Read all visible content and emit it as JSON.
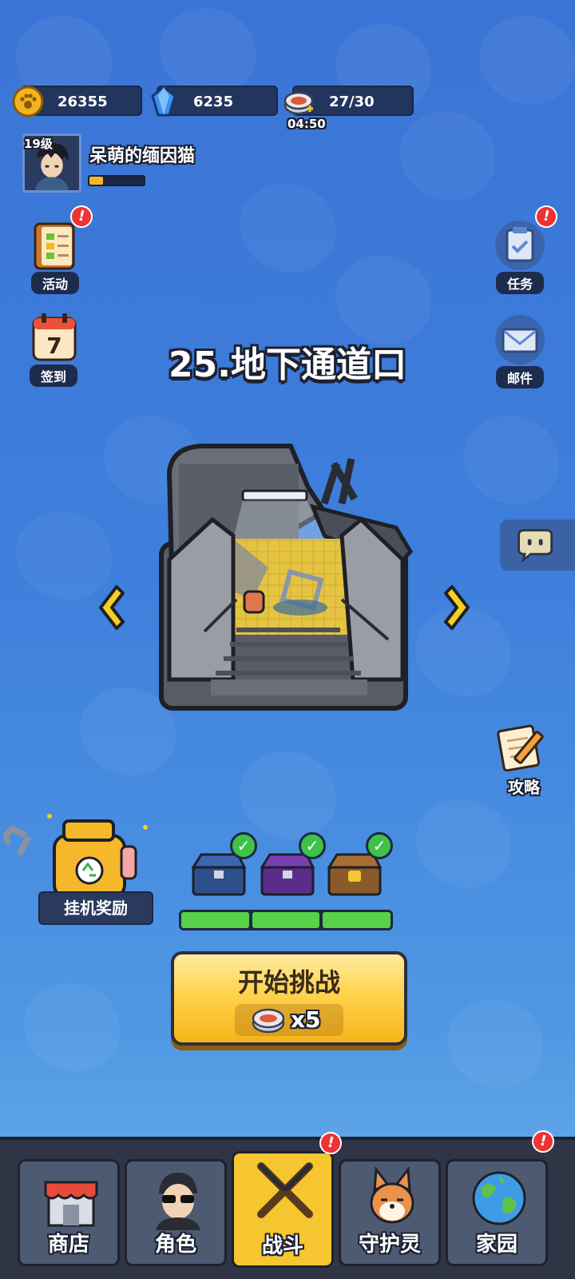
{
  "resources": {
    "coins": "26355",
    "gems": "6235",
    "energy": "27/30",
    "energy_timer": "04:50"
  },
  "profile": {
    "level": "19级",
    "name": "呆萌的缅因猫",
    "xp_fraction": 0.25
  },
  "side_left": {
    "events": "活动",
    "signin": "签到",
    "signin_day": "7"
  },
  "side_right": {
    "tasks": "任务",
    "mail": "邮件",
    "guide": "攻略"
  },
  "stage": {
    "title": "25.地下通道口"
  },
  "idle": {
    "label": "挂机奖励"
  },
  "chest_progress_segments": 3,
  "start": {
    "label": "开始挑战",
    "cost": "x5"
  },
  "nav": {
    "shop": "商店",
    "character": "角色",
    "battle": "战斗",
    "guardian": "守护灵",
    "home": "家园"
  },
  "badges": {
    "alert": "!"
  },
  "colors": {
    "background": "#3e7fdc",
    "accent_yellow": "#f5c62f",
    "progress_green": "#58d14a",
    "badge_red": "#e33333"
  }
}
